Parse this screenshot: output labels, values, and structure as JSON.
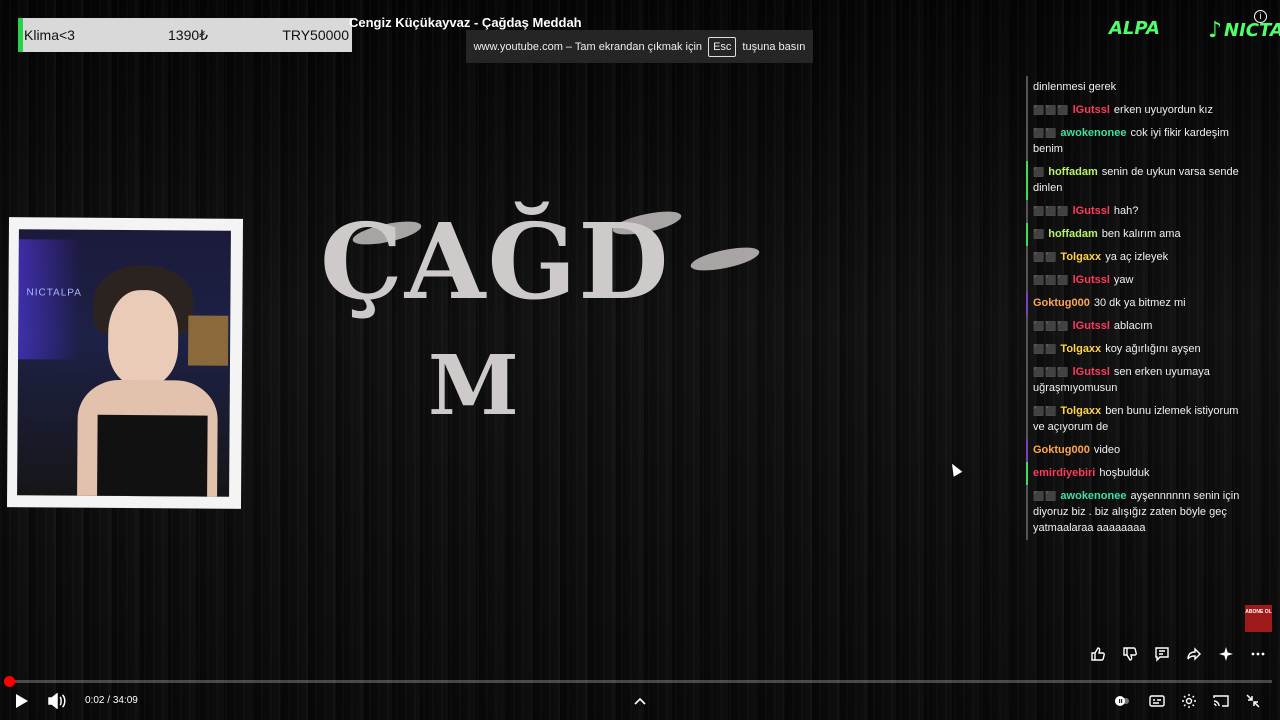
{
  "donation": {
    "name": "Klima<3",
    "amount": "1390₺",
    "goal": "TRY50000"
  },
  "video": {
    "title": "Cengiz Küçükayvaz - Çağdaş Meddah",
    "logo_main": "ÇAĞD",
    "logo_sub": "M"
  },
  "fullscreen_notice": {
    "prefix": "www.youtube.com – Tam ekrandan çıkmak için",
    "key": "Esc",
    "suffix": "tuşuna basın"
  },
  "brands": {
    "left": "ALPA",
    "right": "NICTA"
  },
  "webcam": {
    "sign": "NICTALPA"
  },
  "chat": [
    {
      "user": "",
      "user_color": "#ffffff",
      "text": "dinlenmesi gerek",
      "bar": "#555555",
      "badges": ""
    },
    {
      "user": "lGutssl",
      "user_color": "#ff3b5c",
      "text": "erken uyuyordun kız",
      "bar": "#555555",
      "badges": "⬛⬛⬛"
    },
    {
      "user": "awokenonee",
      "user_color": "#3fe0a0",
      "text": "cok iyi fikir kardeşim benim",
      "bar": "#555555",
      "badges": "⬛⬛"
    },
    {
      "user": "hoffadam",
      "user_color": "#b9f26b",
      "text": "senin de uykun varsa sende dinlen",
      "bar": "#3fdc5a",
      "badges": "⬛"
    },
    {
      "user": "lGutssl",
      "user_color": "#ff3b5c",
      "text": "hah?",
      "bar": "#555555",
      "badges": "⬛⬛⬛"
    },
    {
      "user": "hoffadam",
      "user_color": "#b9f26b",
      "text": "ben kalırım ama",
      "bar": "#3fdc5a",
      "badges": "⬛"
    },
    {
      "user": "Tolgaxx",
      "user_color": "#ffd34a",
      "text": "ya aç izleyek",
      "bar": "#555555",
      "badges": "⬛⬛"
    },
    {
      "user": "lGutssl",
      "user_color": "#ff3b5c",
      "text": "yaw",
      "bar": "#555555",
      "badges": "⬛⬛⬛"
    },
    {
      "user": "Goktug000",
      "user_color": "#ffa552",
      "text": "30 dk ya bitmez mi",
      "bar": "#7a3fbf",
      "badges": ""
    },
    {
      "user": "lGutssl",
      "user_color": "#ff3b5c",
      "text": "ablacım",
      "bar": "#555555",
      "badges": "⬛⬛⬛"
    },
    {
      "user": "Tolgaxx",
      "user_color": "#ffd34a",
      "text": "koy ağırlığını ayşen",
      "bar": "#555555",
      "badges": "⬛⬛"
    },
    {
      "user": "lGutssl",
      "user_color": "#ff3b5c",
      "text": "sen erken uyumaya uğraşmıyomusun",
      "bar": "#555555",
      "badges": "⬛⬛⬛"
    },
    {
      "user": "Tolgaxx",
      "user_color": "#ffd34a",
      "text": "ben bunu izlemek istiyorum ve açıyorum de",
      "bar": "#555555",
      "badges": "⬛⬛"
    },
    {
      "user": "Goktug000",
      "user_color": "#ffa552",
      "text": "video",
      "bar": "#7a3fbf",
      "badges": ""
    },
    {
      "user": "emirdiyebiri",
      "user_color": "#ff3b5c",
      "text": "hoşbulduk",
      "bar": "#3fdc5a",
      "badges": ""
    },
    {
      "user": "awokenonee",
      "user_color": "#3fe0a0",
      "text": "ayşennnnnn senin için diyoruz biz . biz alışığız zaten böyle geç yatmaalaraa aaaaaaaa",
      "bar": "#555555",
      "badges": "⬛⬛"
    }
  ],
  "abone": "ABONE OL",
  "player": {
    "time_current": "0:02",
    "time_total": "34:09",
    "time_sep": " / ",
    "progress": 0.001,
    "accent": "#ff0000"
  },
  "icons": {
    "like": "thumb-up-icon",
    "dislike": "thumb-down-icon",
    "comment": "comment-icon",
    "share": "share-icon",
    "ai": "sparkle-icon",
    "more": "more-icon",
    "play": "play-icon",
    "volume": "volume-icon",
    "chevron": "chevron-up-icon",
    "autoplay": "autoplay-toggle-icon",
    "subtitles": "subtitles-icon",
    "settings": "settings-gear-icon",
    "cast": "cast-icon",
    "exit_fullscreen": "exit-fullscreen-icon"
  }
}
